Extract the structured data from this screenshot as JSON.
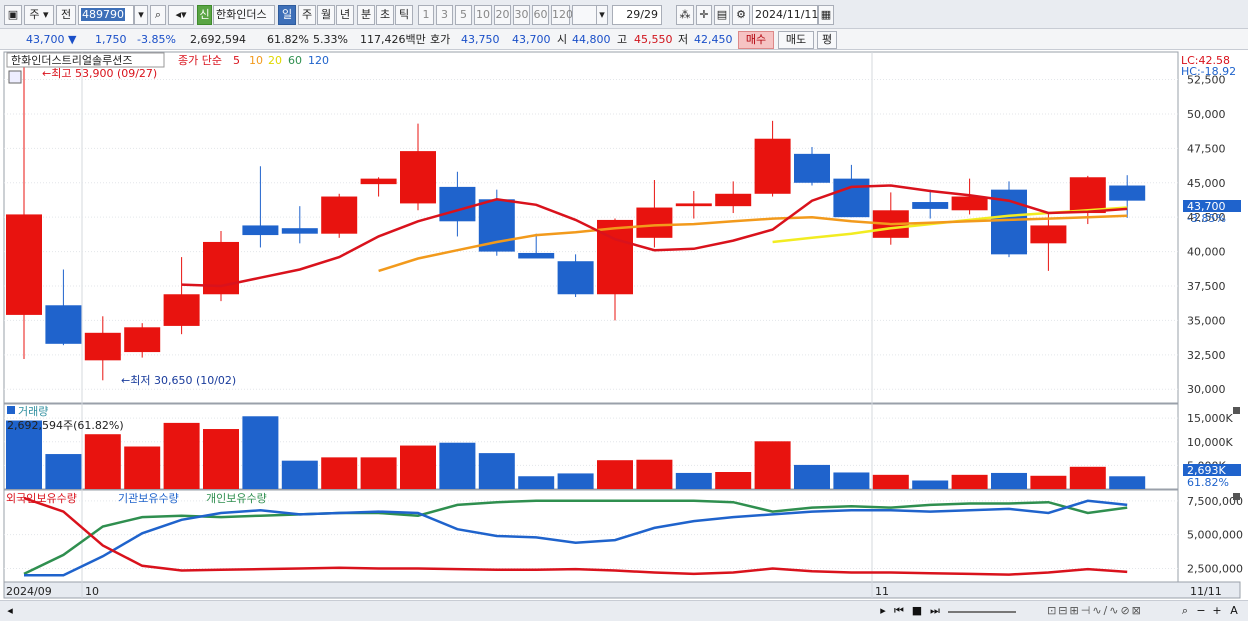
{
  "toolbar": {
    "market": "주",
    "prev": "전",
    "code": "489790",
    "badge": "신",
    "name": "한화인더스",
    "periods": [
      "일",
      "주",
      "월",
      "년",
      "분",
      "초",
      "틱"
    ],
    "periods_selected": "일",
    "intervals": [
      "1",
      "3",
      "5",
      "10",
      "20",
      "30",
      "60",
      "120"
    ],
    "count": "29/29",
    "date": "2024/11/11"
  },
  "infobar": {
    "price": "43,700",
    "change": "1,750",
    "change_pct": "-3.85%",
    "volume": "2,692,594",
    "vol_ratio": "61.82%",
    "turnover": "5.33%",
    "amount": "117,426백만",
    "quote_label": "호가",
    "ask": "43,750",
    "bid": "43,700",
    "open_label": "시",
    "open": "44,800",
    "high_label": "고",
    "high": "45,550",
    "low_label": "저",
    "low": "42,450",
    "buy_label": "매수",
    "sell_label": "매도",
    "avg_label": "평"
  },
  "colors": {
    "up": "#e8130f",
    "down": "#1f63cc",
    "ma5": "#d9121c",
    "ma10": "#f29a1c",
    "ma20": "#f2ec21",
    "foreign": "#d9121c",
    "inst": "#1f63cc",
    "indiv": "#2f8f4f"
  },
  "chart_data": [
    {
      "type": "candlestick",
      "title": "한화인더스트리얼솔루션즈",
      "legend": {
        "label": "종가 단순",
        "periods": [
          "5",
          "10",
          "20",
          "60",
          "120"
        ]
      },
      "annotations": {
        "high": "최고 53,900 (09/27)",
        "low": "최저 30,650 (10/02)"
      },
      "right_info": {
        "lc": "LC:42.58",
        "hc": "HC:-18.92",
        "price_tag": "43,700",
        "pct_tag": "-3.85%"
      },
      "yticks": [
        "52,500",
        "50,000",
        "47,500",
        "45,000",
        "42,500",
        "40,000",
        "37,500",
        "35,000",
        "32,500",
        "30,000"
      ],
      "ylim": [
        29000,
        54500
      ],
      "x_labels": [
        "2024/09",
        "10",
        "11",
        "11/11"
      ],
      "candles": [
        {
          "o": 35400,
          "h": 53900,
          "l": 32200,
          "c": 42700
        },
        {
          "o": 36100,
          "h": 38700,
          "l": 33200,
          "c": 33300
        },
        {
          "o": 32100,
          "h": 35300,
          "l": 30650,
          "c": 34100
        },
        {
          "o": 32700,
          "h": 34800,
          "l": 32300,
          "c": 34500
        },
        {
          "o": 34600,
          "h": 39600,
          "l": 34000,
          "c": 36900
        },
        {
          "o": 36900,
          "h": 41500,
          "l": 36400,
          "c": 40700
        },
        {
          "o": 41900,
          "h": 46200,
          "l": 40300,
          "c": 41200
        },
        {
          "o": 41700,
          "h": 43300,
          "l": 40600,
          "c": 41300
        },
        {
          "o": 41300,
          "h": 44200,
          "l": 41000,
          "c": 44000
        },
        {
          "o": 44900,
          "h": 45400,
          "l": 44000,
          "c": 45300
        },
        {
          "o": 43500,
          "h": 49300,
          "l": 43000,
          "c": 47300
        },
        {
          "o": 44700,
          "h": 45800,
          "l": 41100,
          "c": 42200
        },
        {
          "o": 43800,
          "h": 44500,
          "l": 39700,
          "c": 40000
        },
        {
          "o": 39900,
          "h": 41300,
          "l": 39600,
          "c": 39500
        },
        {
          "o": 39300,
          "h": 39800,
          "l": 36700,
          "c": 36900
        },
        {
          "o": 36900,
          "h": 42400,
          "l": 35000,
          "c": 42300
        },
        {
          "o": 41000,
          "h": 45200,
          "l": 40300,
          "c": 43200
        },
        {
          "o": 43300,
          "h": 44400,
          "l": 42400,
          "c": 43500
        },
        {
          "o": 43300,
          "h": 45100,
          "l": 42800,
          "c": 44200
        },
        {
          "o": 44200,
          "h": 49500,
          "l": 44000,
          "c": 48200
        },
        {
          "o": 47100,
          "h": 47600,
          "l": 44800,
          "c": 45000
        },
        {
          "o": 45300,
          "h": 46300,
          "l": 42500,
          "c": 42500
        },
        {
          "o": 41000,
          "h": 44300,
          "l": 40500,
          "c": 43000
        },
        {
          "o": 43600,
          "h": 44500,
          "l": 42400,
          "c": 43100
        },
        {
          "o": 43000,
          "h": 45300,
          "l": 42700,
          "c": 44000
        },
        {
          "o": 44500,
          "h": 45100,
          "l": 39600,
          "c": 39800
        },
        {
          "o": 40600,
          "h": 42800,
          "l": 38600,
          "c": 41900
        },
        {
          "o": 42800,
          "h": 45500,
          "l": 42000,
          "c": 45400
        },
        {
          "o": 44800,
          "h": 45550,
          "l": 42450,
          "c": 43700
        }
      ],
      "ma5": [
        null,
        null,
        null,
        null,
        37600,
        37500,
        38100,
        38700,
        39600,
        41100,
        42200,
        43000,
        43800,
        43400,
        42300,
        40900,
        40100,
        40200,
        40800,
        41600,
        43700,
        44700,
        44800,
        44400,
        44100,
        43700,
        42800,
        42900,
        43100
      ],
      "ma10": [
        null,
        null,
        null,
        null,
        null,
        null,
        null,
        null,
        null,
        38600,
        39500,
        40100,
        40700,
        41200,
        41400,
        41700,
        41900,
        42000,
        42200,
        42400,
        42500,
        42200,
        42000,
        42100,
        42200,
        42300,
        42400,
        42500,
        42600
      ],
      "ma20": [
        null,
        null,
        null,
        null,
        null,
        null,
        null,
        null,
        null,
        null,
        null,
        null,
        null,
        null,
        null,
        null,
        null,
        null,
        null,
        40700,
        41000,
        41300,
        41700,
        42000,
        42300,
        42600,
        42800,
        43000,
        43200
      ]
    },
    {
      "type": "bar",
      "title": "거래량",
      "readout": "2,692,594주(61.82%)",
      "right_tags": [
        "2,693K",
        "61.82%"
      ],
      "yticks": [
        "15,000K",
        "10,000K",
        "5,000K"
      ],
      "ylim": [
        0,
        18000000
      ],
      "values": [
        14500000,
        7400000,
        11600000,
        9000000,
        14000000,
        12700000,
        15400000,
        6000000,
        6700000,
        6700000,
        9200000,
        9800000,
        7600000,
        2700000,
        3300000,
        6100000,
        6200000,
        3400000,
        3600000,
        10100000,
        5100000,
        3500000,
        3000000,
        1800000,
        3000000,
        3400000,
        2800000,
        4700000,
        2692594
      ],
      "directions": [
        "down",
        "down",
        "up",
        "up",
        "up",
        "up",
        "down",
        "down",
        "up",
        "up",
        "up",
        "down",
        "down",
        "down",
        "down",
        "up",
        "up",
        "down",
        "up",
        "up",
        "down",
        "down",
        "up",
        "down",
        "up",
        "down",
        "up",
        "up",
        "down"
      ]
    },
    {
      "type": "line",
      "series_names": [
        "외국인보유수량",
        "기관보유수량",
        "개인보유수량"
      ],
      "yticks": [
        "7,500,000",
        "5,000,000",
        "2,500,000"
      ],
      "ylim": [
        1500000,
        8300000
      ],
      "foreign": [
        7700000,
        6700000,
        4200000,
        2700000,
        2350000,
        2400000,
        2450000,
        2500000,
        2550000,
        2500000,
        2500000,
        2450000,
        2400000,
        2400000,
        2450000,
        2350000,
        2200000,
        2100000,
        2200000,
        2500000,
        2300000,
        2200000,
        2200000,
        2150000,
        2100000,
        2050000,
        2200000,
        2450000,
        2250000
      ],
      "inst": [
        2000000,
        2000000,
        3400000,
        5100000,
        6100000,
        6600000,
        6800000,
        6500000,
        6600000,
        6700000,
        6600000,
        5400000,
        4900000,
        4800000,
        4400000,
        4600000,
        5500000,
        6000000,
        6300000,
        6500000,
        6700000,
        6800000,
        6800000,
        6700000,
        6800000,
        6900000,
        6600000,
        7500000,
        7200000
      ],
      "indiv": [
        2100000,
        3500000,
        5600000,
        6300000,
        6400000,
        6300000,
        6400000,
        6500000,
        6600000,
        6600000,
        6400000,
        7200000,
        7400000,
        7500000,
        7500000,
        7500000,
        7500000,
        7500000,
        7400000,
        6700000,
        7000000,
        7100000,
        7000000,
        7200000,
        7300000,
        7300000,
        7400000,
        6600000,
        7000000
      ]
    }
  ]
}
